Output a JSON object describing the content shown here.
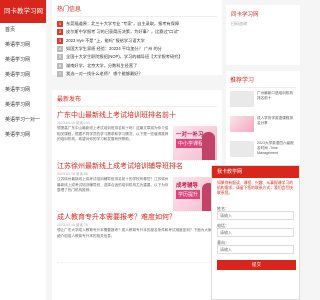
{
  "brand": {
    "title": "同卡教学习网",
    "accent": "#d9261c"
  },
  "sidebar": {
    "items": [
      {
        "label": "首页"
      },
      {
        "label": "英语学习网"
      },
      {
        "label": "英语学习网"
      },
      {
        "label": "英语学习网"
      },
      {
        "label": "英语学习网"
      },
      {
        "label": "英语学习网"
      },
      {
        "label": "英语学习一对一"
      },
      {
        "label": "英语学习网"
      }
    ]
  },
  "hot": {
    "title": "热门信息",
    "items": [
      {
        "num": "1",
        "text": "东莞福道原：北三十大学专业 \"专家\"，自主录取，报考有保障"
      },
      {
        "num": "2",
        "text": "皮尔斯中学报考 习的已获简历决策，为好事？，比赛过\"口试\""
      },
      {
        "num": "3",
        "text": "2023 Hye 不是 \"上，能吗\" 报给学习语大学"
      },
      {
        "num": "4",
        "text": "如国大学生家原 经验：20224 平均加分？ 广州 的分"
      },
      {
        "num": "5",
        "text": "全国十大学生职院报招(NOP)，学习的辅导班【大学报考研究】"
      },
      {
        "num": "6",
        "text": "湖南好学，北京大学，分数科生经营了"
      },
      {
        "num": "7",
        "text": "我选一对一找什么老师？ 哪个能够最好？"
      }
    ]
  },
  "latest": {
    "title": "最新发布",
    "articles": [
      {
        "title": "广东中山最新线上考试培训班排名前十",
        "meta": "2023-04-16 阅读:100",
        "text": "想提高广东中山最新线上考试培训班排名前十吗？这篇文章将为你介绍相关课程，根据不同学员的学习需求和学习情况，以下是一些值得推荐的培训机构，希望对你的学习和发展有所帮助。",
        "thumb_line1": "一对一补习",
        "thumb_line2": "中小学课程"
      },
      {
        "title": "江苏徐州最新线上成考试培训辅导班排名",
        "meta": "2023-03-16 阅读:88",
        "text": "江苏徐州最新线上成考试培训辅导班排名前十的学校有哪些？江苏徐州最新线上成考试培训辅导班，选择合适的培训机构尤为重要，以下为你整理了热门机构推荐。",
        "thumb_line1": "成考辅导",
        "thumb_line2": "学历提升"
      },
      {
        "title": "成人教育专升本需要报考？难度如何？",
        "meta": "2023-03-16 阅读:75",
        "text": "想让广东大学成人教育专升本需要报考？成人教育专升本的报名条件和考试难度如何？下面为大家详细介绍成人教育专升本的相关信息。",
        "thumb_line1": "",
        "thumb_line2": ""
      }
    ]
  },
  "right": {
    "qr_title": "同卡学习网",
    "qr_sub": "扫码咨询",
    "rec_title": "推荐学习",
    "rec": [
      {
        "text": "广州最新口语培训机构排名前十"
      },
      {
        "text": "成人学历学英语课程排名分享"
      },
      {
        "text": "2023大学英语四六级报名时间 -Time Management"
      },
      {
        "text": "出国留学语言学校推荐"
      }
    ]
  },
  "popup": {
    "title": "我卡教学网",
    "desc": "如果你有报读、课程、兴趣、从事报课学习的机构需求，请留下您的联系方式，我们会尽快联系您。",
    "fields": [
      {
        "label": "姓名：",
        "placeholder": "请输入"
      },
      {
        "label": "电话：",
        "placeholder": "请输入"
      },
      {
        "label": "意向：",
        "placeholder": "请输入"
      }
    ],
    "submit": "提交"
  }
}
